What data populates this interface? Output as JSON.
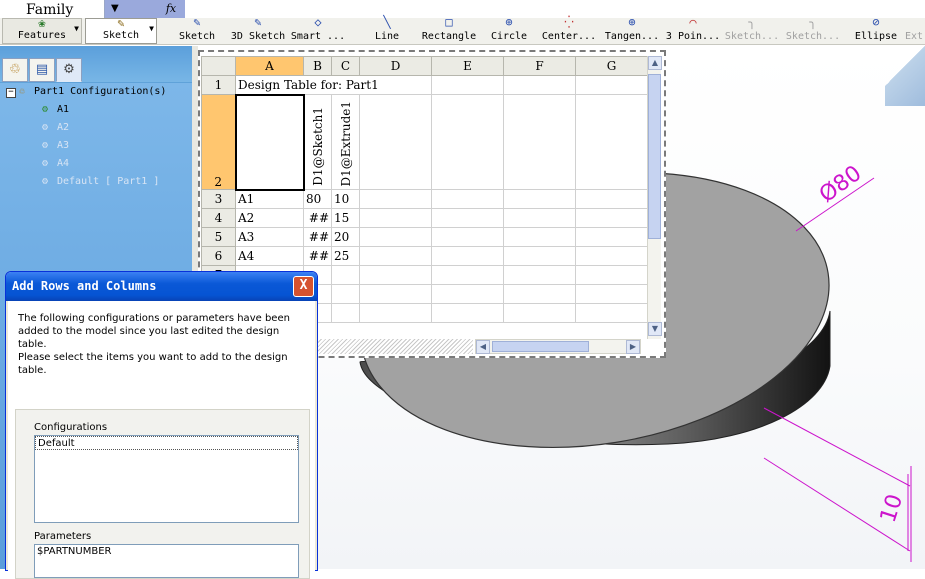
{
  "namebar": {
    "name_box_value": "Family",
    "fx_label": "fx"
  },
  "toolbar": {
    "features_label": "Features",
    "sketch_group_label": "Sketch",
    "buttons": [
      {
        "label": "Sketch",
        "icon": "sketch-icon",
        "enabled": true
      },
      {
        "label": "3D Sketch",
        "icon": "3d-sketch-icon",
        "enabled": true
      },
      {
        "label": "Smart ...",
        "icon": "smart-dimension-icon",
        "enabled": true
      },
      {
        "label": "Line",
        "icon": "line-icon",
        "enabled": true
      },
      {
        "label": "Rectangle",
        "icon": "rectangle-icon",
        "enabled": true
      },
      {
        "label": "Circle",
        "icon": "circle-icon",
        "enabled": true
      },
      {
        "label": "Center...",
        "icon": "centerpoint-arc-icon",
        "enabled": true
      },
      {
        "label": "Tangen...",
        "icon": "tangent-arc-icon",
        "enabled": true
      },
      {
        "label": "3 Poin...",
        "icon": "3point-arc-icon",
        "enabled": true
      },
      {
        "label": "Sketch...",
        "icon": "sketch-fillet-icon",
        "enabled": false
      },
      {
        "label": "Sketch...",
        "icon": "sketch-chamfer-icon",
        "enabled": false
      },
      {
        "label": "Ellipse",
        "icon": "ellipse-icon",
        "enabled": true
      },
      {
        "label": "Ext",
        "icon": "extend-icon",
        "enabled": false
      }
    ]
  },
  "feature_manager": {
    "root_label": "Part1 Configuration(s)",
    "items": [
      {
        "label": "A1",
        "active": true
      },
      {
        "label": "A2",
        "active": false
      },
      {
        "label": "A3",
        "active": false
      },
      {
        "label": "A4",
        "active": false
      },
      {
        "label": "Default [ Part1 ]",
        "active": false
      }
    ]
  },
  "spreadsheet": {
    "columns": [
      "A",
      "B",
      "C",
      "D",
      "E",
      "F",
      "G"
    ],
    "selected_column": "A",
    "selected_row": "2",
    "title_cell": "Design Table for: Part1",
    "header_b": "D1@Sketch1",
    "header_c": "D1@Extrude1",
    "rows": [
      {
        "num": "3",
        "a": "A1",
        "b": "80",
        "c": "10"
      },
      {
        "num": "4",
        "a": "A2",
        "b": "##",
        "c": "15"
      },
      {
        "num": "5",
        "a": "A3",
        "b": "##",
        "c": "20"
      },
      {
        "num": "6",
        "a": "A4",
        "b": "##",
        "c": "25"
      }
    ],
    "row_1": "1",
    "row_2": "2",
    "row_7": "7"
  },
  "dialog": {
    "title": "Add Rows and Columns",
    "close_label": "X",
    "message_1": "The following configurations or parameters have been added to the model since you last edited the design table.",
    "message_2": "Please select the items you want to add to the design table.",
    "configurations_label": "Configurations",
    "configurations": [
      "Default"
    ],
    "parameters_label": "Parameters",
    "parameters": [
      "$PARTNUMBER"
    ]
  },
  "model": {
    "diameter_label": "Ø80",
    "thickness_label": "10",
    "annotation_color": "#cc14cc"
  },
  "colors": {
    "fm_background": "#5fa2d9",
    "selection_header": "#ffc66f",
    "dialog_title": "#0654d3"
  }
}
